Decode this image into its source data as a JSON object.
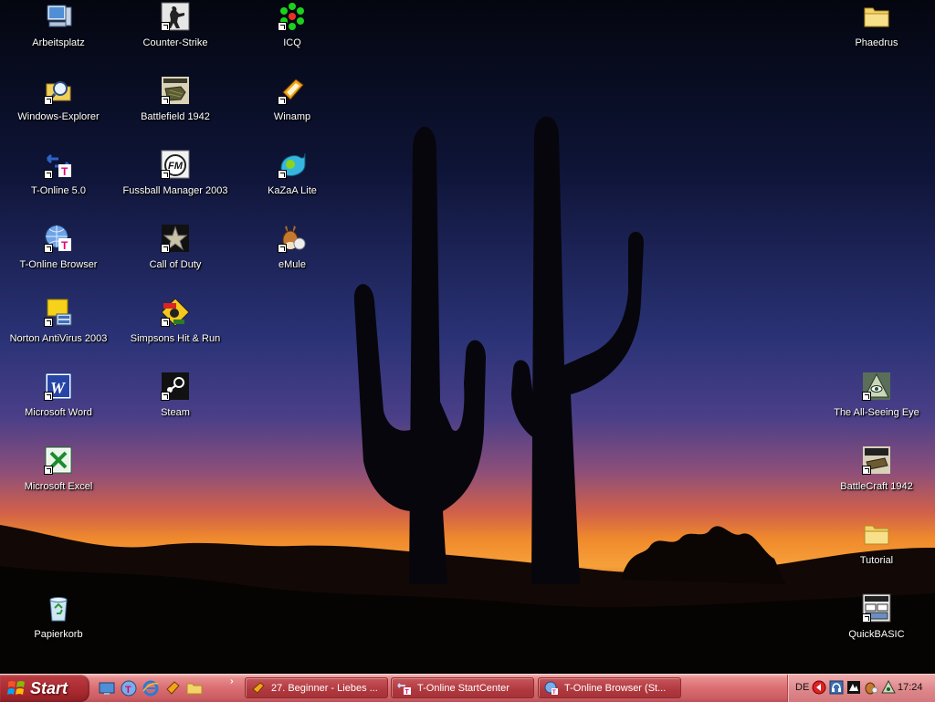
{
  "desktop": {
    "icons": [
      {
        "label": "Arbeitsplatz"
      },
      {
        "label": "Windows-Explorer"
      },
      {
        "label": "T-Online 5.0"
      },
      {
        "label": "T-Online Browser"
      },
      {
        "label": "Norton AntiVirus 2003"
      },
      {
        "label": "Microsoft Word"
      },
      {
        "label": "Microsoft Excel"
      },
      {
        "label": "Papierkorb"
      },
      {
        "label": "Counter-Strike"
      },
      {
        "label": "Battlefield 1942"
      },
      {
        "label": "Fussball Manager 2003"
      },
      {
        "label": "Call of Duty"
      },
      {
        "label": "Simpsons Hit & Run"
      },
      {
        "label": "Steam"
      },
      {
        "label": "ICQ"
      },
      {
        "label": "Winamp"
      },
      {
        "label": "KaZaA Lite"
      },
      {
        "label": "eMule"
      },
      {
        "label": "Phaedrus"
      },
      {
        "label": "The All-Seeing Eye"
      },
      {
        "label": "BattleCraft 1942"
      },
      {
        "label": "Tutorial"
      },
      {
        "label": "QuickBASIC"
      }
    ]
  },
  "taskbar": {
    "start_label": "Start",
    "quicklaunch": [
      "show-desktop-icon",
      "t-online-icon",
      "internet-explorer-icon",
      "winamp-icon",
      "folder-icon"
    ],
    "tasks": [
      {
        "label": "27. Beginner - Liebes ..."
      },
      {
        "label": "T-Online StartCenter"
      },
      {
        "label": "T-Online Browser (St..."
      }
    ],
    "tray": {
      "language": "DE",
      "clock": "17:24"
    }
  },
  "colors": {
    "taskbar": "#d96d72",
    "start_button": "#a92b31",
    "sky_top": "#05081c",
    "sky_mid": "#2a3374",
    "sunset_orange": "#f08a2a"
  }
}
